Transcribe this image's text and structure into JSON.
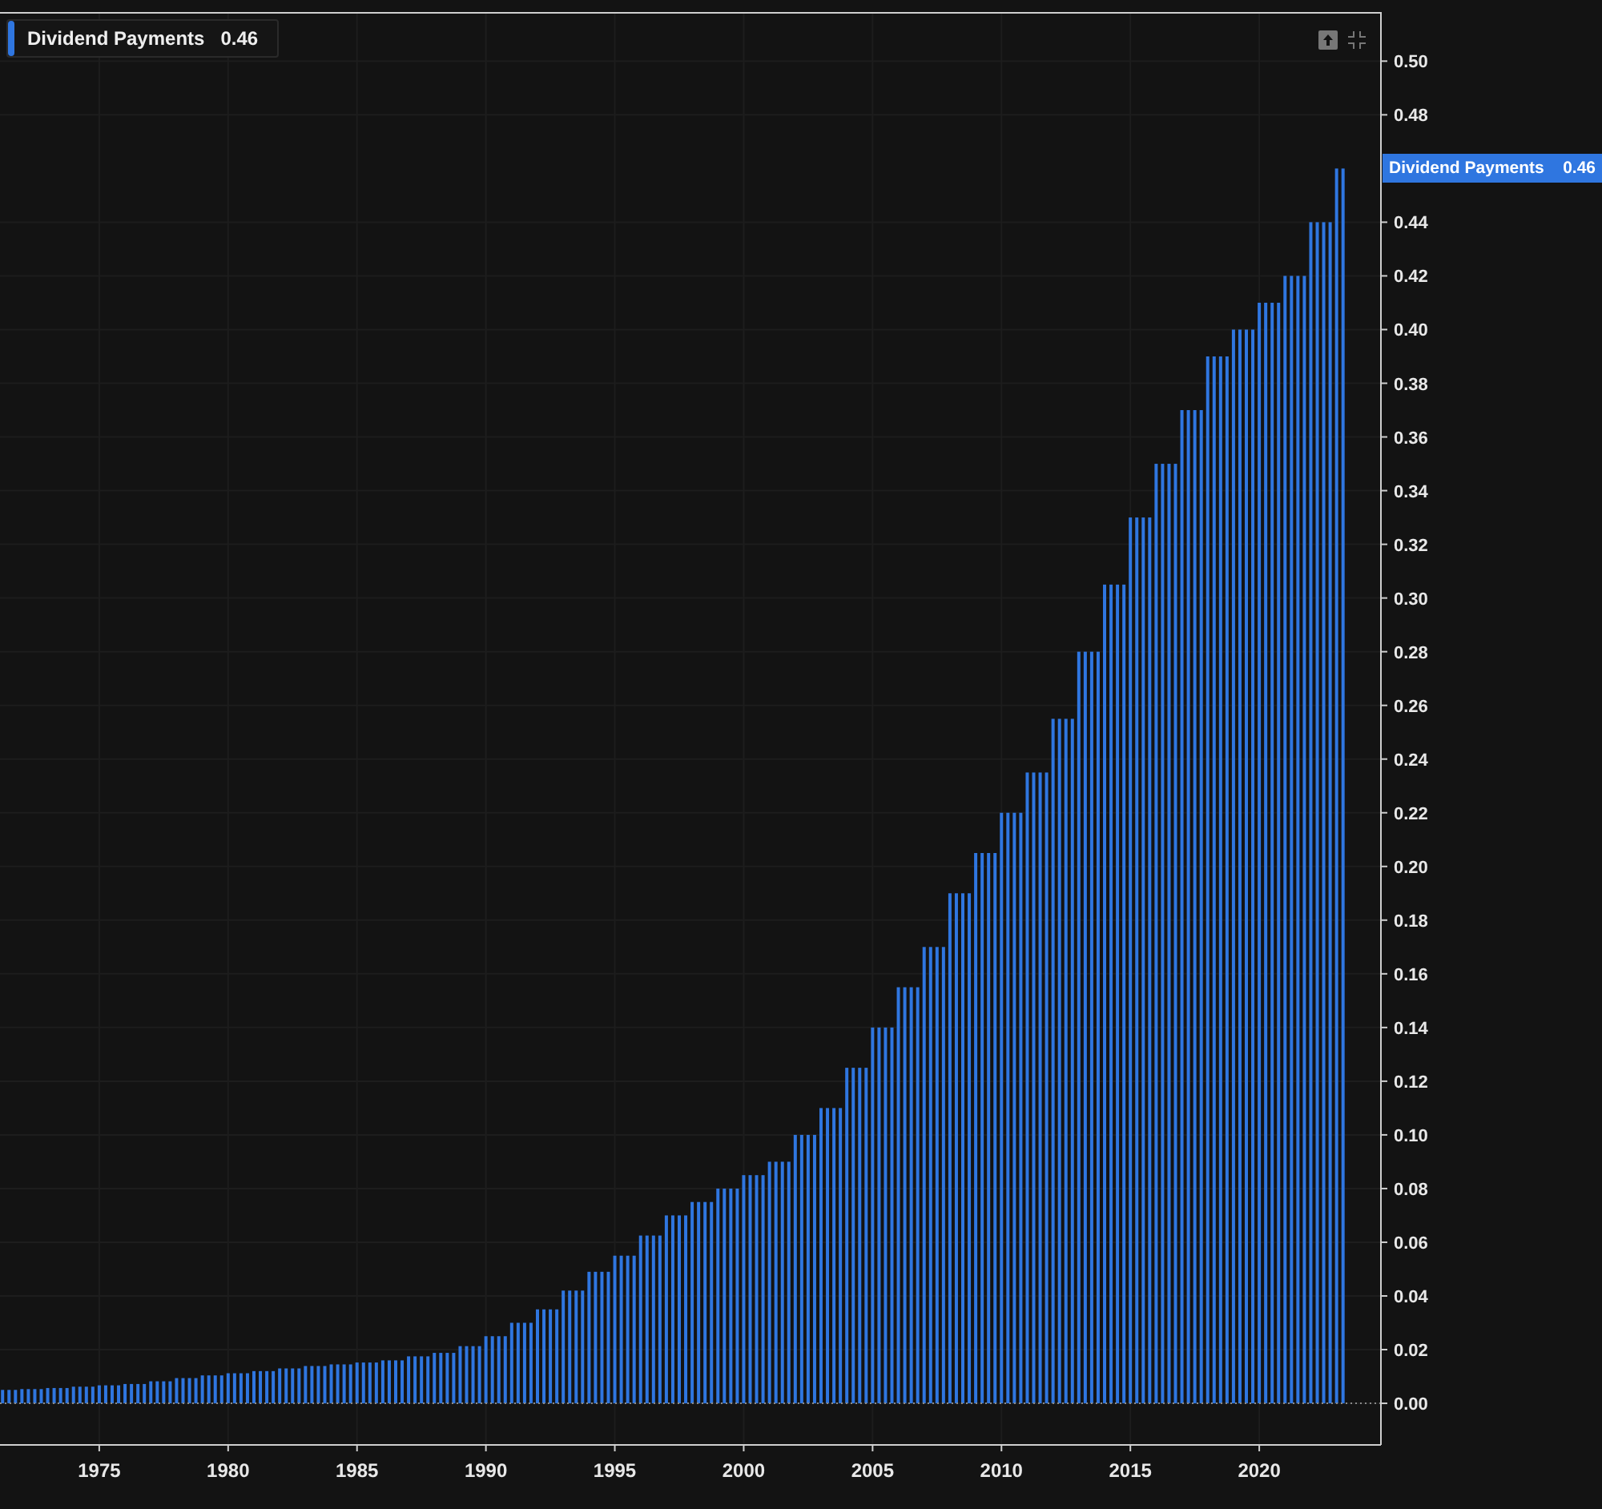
{
  "legend": {
    "value": "0.46"
  },
  "price_tag": {
    "label": "Dividend Payments",
    "value": "0.46"
  },
  "chart_data": {
    "type": "bar",
    "xlim": [
      1971.15,
      2024.72
    ],
    "ylim": [
      -0.0155,
      0.518
    ],
    "grid": true,
    "ref_lines": [
      {
        "axis": "y",
        "value": 0
      }
    ],
    "xticks": [
      1975,
      1980,
      1985,
      1990,
      1995,
      2000,
      2005,
      2010,
      2015,
      2020
    ],
    "yticks": [
      {
        "value": 0,
        "label": "0.00"
      },
      {
        "value": 0.02,
        "label": "0.02"
      },
      {
        "value": 0.04,
        "label": "0.04"
      },
      {
        "value": 0.06,
        "label": "0.06"
      },
      {
        "value": 0.08,
        "label": "0.08"
      },
      {
        "value": 0.1,
        "label": "0.10"
      },
      {
        "value": 0.12,
        "label": "0.12"
      },
      {
        "value": 0.14,
        "label": "0.14"
      },
      {
        "value": 0.16,
        "label": "0.16"
      },
      {
        "value": 0.18,
        "label": "0.18"
      },
      {
        "value": 0.2,
        "label": "0.20"
      },
      {
        "value": 0.22,
        "label": "0.22"
      },
      {
        "value": 0.24,
        "label": "0.24"
      },
      {
        "value": 0.26,
        "label": "0.26"
      },
      {
        "value": 0.28,
        "label": "0.28"
      },
      {
        "value": 0.3,
        "label": "0.30"
      },
      {
        "value": 0.32,
        "label": "0.32"
      },
      {
        "value": 0.34,
        "label": "0.34"
      },
      {
        "value": 0.36,
        "label": "0.36"
      },
      {
        "value": 0.38,
        "label": "0.38"
      },
      {
        "value": 0.4,
        "label": "0.40"
      },
      {
        "value": 0.42,
        "label": "0.42"
      },
      {
        "value": 0.44,
        "label": "0.44"
      },
      {
        "value": 0.48,
        "label": "0.48"
      },
      {
        "value": 0.5,
        "label": "0.50"
      }
    ],
    "x": [
      1971.25,
      1971.5,
      1971.75,
      1972,
      1972.25,
      1972.5,
      1972.75,
      1973,
      1973.25,
      1973.5,
      1973.75,
      1974,
      1974.25,
      1974.5,
      1974.75,
      1975,
      1975.25,
      1975.5,
      1975.75,
      1976,
      1976.25,
      1976.5,
      1976.75,
      1977,
      1977.25,
      1977.5,
      1977.75,
      1978,
      1978.25,
      1978.5,
      1978.75,
      1979,
      1979.25,
      1979.5,
      1979.75,
      1980,
      1980.25,
      1980.5,
      1980.75,
      1981,
      1981.25,
      1981.5,
      1981.75,
      1982,
      1982.25,
      1982.5,
      1982.75,
      1983,
      1983.25,
      1983.5,
      1983.75,
      1984,
      1984.25,
      1984.5,
      1984.75,
      1985,
      1985.25,
      1985.5,
      1985.75,
      1986,
      1986.25,
      1986.5,
      1986.75,
      1987,
      1987.25,
      1987.5,
      1987.75,
      1988,
      1988.25,
      1988.5,
      1988.75,
      1989,
      1989.25,
      1989.5,
      1989.75,
      1990,
      1990.25,
      1990.5,
      1990.75,
      1991,
      1991.25,
      1991.5,
      1991.75,
      1992,
      1992.25,
      1992.5,
      1992.75,
      1993,
      1993.25,
      1993.5,
      1993.75,
      1994,
      1994.25,
      1994.5,
      1994.75,
      1995,
      1995.25,
      1995.5,
      1995.75,
      1996,
      1996.25,
      1996.5,
      1996.75,
      1997,
      1997.25,
      1997.5,
      1997.75,
      1998,
      1998.25,
      1998.5,
      1998.75,
      1999,
      1999.25,
      1999.5,
      1999.75,
      2000,
      2000.25,
      2000.5,
      2000.75,
      2001,
      2001.25,
      2001.5,
      2001.75,
      2002,
      2002.25,
      2002.5,
      2002.75,
      2003,
      2003.25,
      2003.5,
      2003.75,
      2004,
      2004.25,
      2004.5,
      2004.75,
      2005,
      2005.25,
      2005.5,
      2005.75,
      2006,
      2006.25,
      2006.5,
      2006.75,
      2007,
      2007.25,
      2007.5,
      2007.75,
      2008,
      2008.25,
      2008.5,
      2008.75,
      2009,
      2009.25,
      2009.5,
      2009.75,
      2010,
      2010.25,
      2010.5,
      2010.75,
      2011,
      2011.25,
      2011.5,
      2011.75,
      2012,
      2012.25,
      2012.5,
      2012.75,
      2013,
      2013.25,
      2013.5,
      2013.75,
      2014,
      2014.25,
      2014.5,
      2014.75,
      2015,
      2015.25,
      2015.5,
      2015.75,
      2016,
      2016.25,
      2016.5,
      2016.75,
      2017,
      2017.25,
      2017.5,
      2017.75,
      2018,
      2018.25,
      2018.5,
      2018.75,
      2019,
      2019.25,
      2019.5,
      2019.75,
      2020,
      2020.25,
      2020.5,
      2020.75,
      2021,
      2021.25,
      2021.5,
      2021.75,
      2022,
      2022.25,
      2022.5,
      2022.75,
      2023,
      2023.25
    ],
    "series": [
      {
        "name": "Dividend Payments",
        "color": "#2f76e0",
        "values": [
          0.005,
          0.005,
          0.005,
          0.0053,
          0.0053,
          0.0053,
          0.0053,
          0.0057,
          0.0057,
          0.0057,
          0.0057,
          0.0062,
          0.0062,
          0.0062,
          0.0062,
          0.0067,
          0.0067,
          0.0067,
          0.0067,
          0.0072,
          0.0072,
          0.0072,
          0.0072,
          0.0082,
          0.0082,
          0.0082,
          0.0082,
          0.0094,
          0.0094,
          0.0094,
          0.0094,
          0.0104,
          0.0104,
          0.0104,
          0.0104,
          0.0112,
          0.0112,
          0.0112,
          0.0112,
          0.012,
          0.012,
          0.012,
          0.012,
          0.013,
          0.013,
          0.013,
          0.013,
          0.0139,
          0.0139,
          0.0139,
          0.0139,
          0.0145,
          0.0145,
          0.0145,
          0.0145,
          0.0152,
          0.0152,
          0.0152,
          0.0152,
          0.016,
          0.016,
          0.016,
          0.016,
          0.0175,
          0.0175,
          0.0175,
          0.0175,
          0.0188,
          0.0188,
          0.0188,
          0.0188,
          0.0213,
          0.0213,
          0.0213,
          0.0213,
          0.025,
          0.025,
          0.025,
          0.025,
          0.03,
          0.03,
          0.03,
          0.03,
          0.035,
          0.035,
          0.035,
          0.035,
          0.042,
          0.042,
          0.042,
          0.042,
          0.049,
          0.049,
          0.049,
          0.049,
          0.055,
          0.055,
          0.055,
          0.055,
          0.0625,
          0.0625,
          0.0625,
          0.0625,
          0.07,
          0.07,
          0.07,
          0.07,
          0.075,
          0.075,
          0.075,
          0.075,
          0.08,
          0.08,
          0.08,
          0.08,
          0.085,
          0.085,
          0.085,
          0.085,
          0.09,
          0.09,
          0.09,
          0.09,
          0.1,
          0.1,
          0.1,
          0.1,
          0.11,
          0.11,
          0.11,
          0.11,
          0.125,
          0.125,
          0.125,
          0.125,
          0.14,
          0.14,
          0.14,
          0.14,
          0.155,
          0.155,
          0.155,
          0.155,
          0.17,
          0.17,
          0.17,
          0.17,
          0.19,
          0.19,
          0.19,
          0.19,
          0.205,
          0.205,
          0.205,
          0.205,
          0.22,
          0.22,
          0.22,
          0.22,
          0.235,
          0.235,
          0.235,
          0.235,
          0.255,
          0.255,
          0.255,
          0.255,
          0.28,
          0.28,
          0.28,
          0.28,
          0.305,
          0.305,
          0.305,
          0.305,
          0.33,
          0.33,
          0.33,
          0.33,
          0.35,
          0.35,
          0.35,
          0.35,
          0.37,
          0.37,
          0.37,
          0.37,
          0.39,
          0.39,
          0.39,
          0.39,
          0.4,
          0.4,
          0.4,
          0.4,
          0.41,
          0.41,
          0.41,
          0.41,
          0.42,
          0.42,
          0.42,
          0.42,
          0.44,
          0.44,
          0.44,
          0.44,
          0.46,
          0.46
        ]
      }
    ]
  }
}
